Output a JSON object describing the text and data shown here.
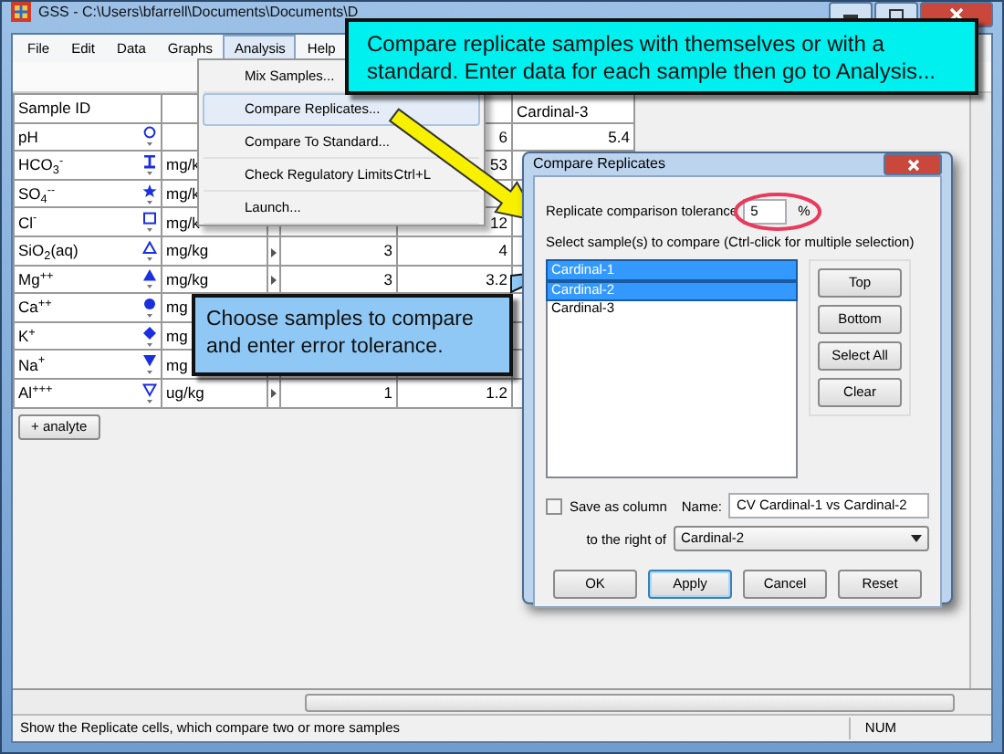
{
  "window": {
    "title": "GSS - C:\\Users\\bfarrell\\Documents\\Documents\\D"
  },
  "menu_bar": [
    {
      "label": "File",
      "selected": false
    },
    {
      "label": "Edit",
      "selected": false
    },
    {
      "label": "Data",
      "selected": false
    },
    {
      "label": "Graphs",
      "selected": false
    },
    {
      "label": "Analysis",
      "selected": true
    },
    {
      "label": "Help",
      "selected": false
    }
  ],
  "analysis_menu": [
    {
      "label": "Mix Samples...",
      "selected": false
    },
    {
      "label": "Compare Replicates...",
      "selected": true
    },
    {
      "label": "Compare To Standard...",
      "selected": false
    },
    {
      "label": "Check Regulatory Limits",
      "shortcut": "Ctrl+L",
      "selected": false
    },
    {
      "label": "Launch...",
      "selected": false
    }
  ],
  "table": {
    "name_header": "Sample ID",
    "value_header": "Cardinal-3",
    "rows": [
      {
        "name": "pH",
        "kind": "circle-open",
        "column_5": "6",
        "column_6": "5.4"
      },
      {
        "name": "HCO$_{3}$$^{-}$",
        "kind": "ibeam",
        "unit": "mg/k",
        "column_5": "53"
      },
      {
        "name": "SO$_{4}$$^{--}$",
        "kind": "star",
        "unit": "mg/k"
      },
      {
        "name": "Cl$^{-}$",
        "kind": "square-open",
        "unit": "mg/k",
        "column_5": "12"
      },
      {
        "name": "SiO$_{2}$(aq)",
        "kind": "triangle-open",
        "unit": "mg/kg",
        "expander": true,
        "column_4": "3",
        "column_5": "4"
      },
      {
        "name": "Mg$^{++}$",
        "kind": "triangle",
        "unit": "mg/kg",
        "expander": true,
        "column_4": "3",
        "column_5": "3.2"
      },
      {
        "name": "Ca$^{++}$",
        "kind": "circle",
        "unit": "mg"
      },
      {
        "name": "K$^{+}$",
        "kind": "diamond",
        "unit": "mg"
      },
      {
        "name": "Na$^{+}$",
        "kind": "triangle-down",
        "unit": "mg"
      },
      {
        "name": "Al$^{+++}$",
        "kind": "triangle-down-open",
        "unit": "ug/kg",
        "expander": true,
        "column_4": "1",
        "column_5": "1.2"
      }
    ]
  },
  "add_button": "+ analyte",
  "status_bar": {
    "message": "Show the Replicate cells, which compare two or more samples",
    "indicator": "NUM"
  },
  "callouts": [
    {
      "kind": "banner",
      "text": "Compare replicate samples with themselves or with a standard. Enter data for each sample then go to Analysis..."
    },
    {
      "kind": "tip",
      "text": "Choose samples to compare and enter error tolerance."
    }
  ],
  "dialog": {
    "title": "Compare Replicates",
    "tolerance_label": "Replicate comparison tolerance",
    "tolerance": "5",
    "tolerance_unit": "%",
    "select_label": "Select sample(s) to compare (Ctrl-click for multiple selection)",
    "samples": [
      {
        "label": "Cardinal-1",
        "selected": true
      },
      {
        "label": "Cardinal-2",
        "selected": true
      },
      {
        "label": "Cardinal-3",
        "selected": false
      }
    ],
    "side_buttons": [
      "Top",
      "Bottom",
      "Select All",
      "Clear"
    ],
    "save_as_column": {
      "label": "Save as column",
      "checked": false
    },
    "name_label": "Name:",
    "name": "CV Cardinal-1 vs Cardinal-2",
    "position_label": "to the right of",
    "position": "Cardinal-2",
    "buttons": [
      {
        "label": "OK",
        "selected": false
      },
      {
        "label": "Apply",
        "selected": true
      },
      {
        "label": "Cancel",
        "selected": false
      },
      {
        "label": "Reset",
        "selected": false
      }
    ]
  }
}
